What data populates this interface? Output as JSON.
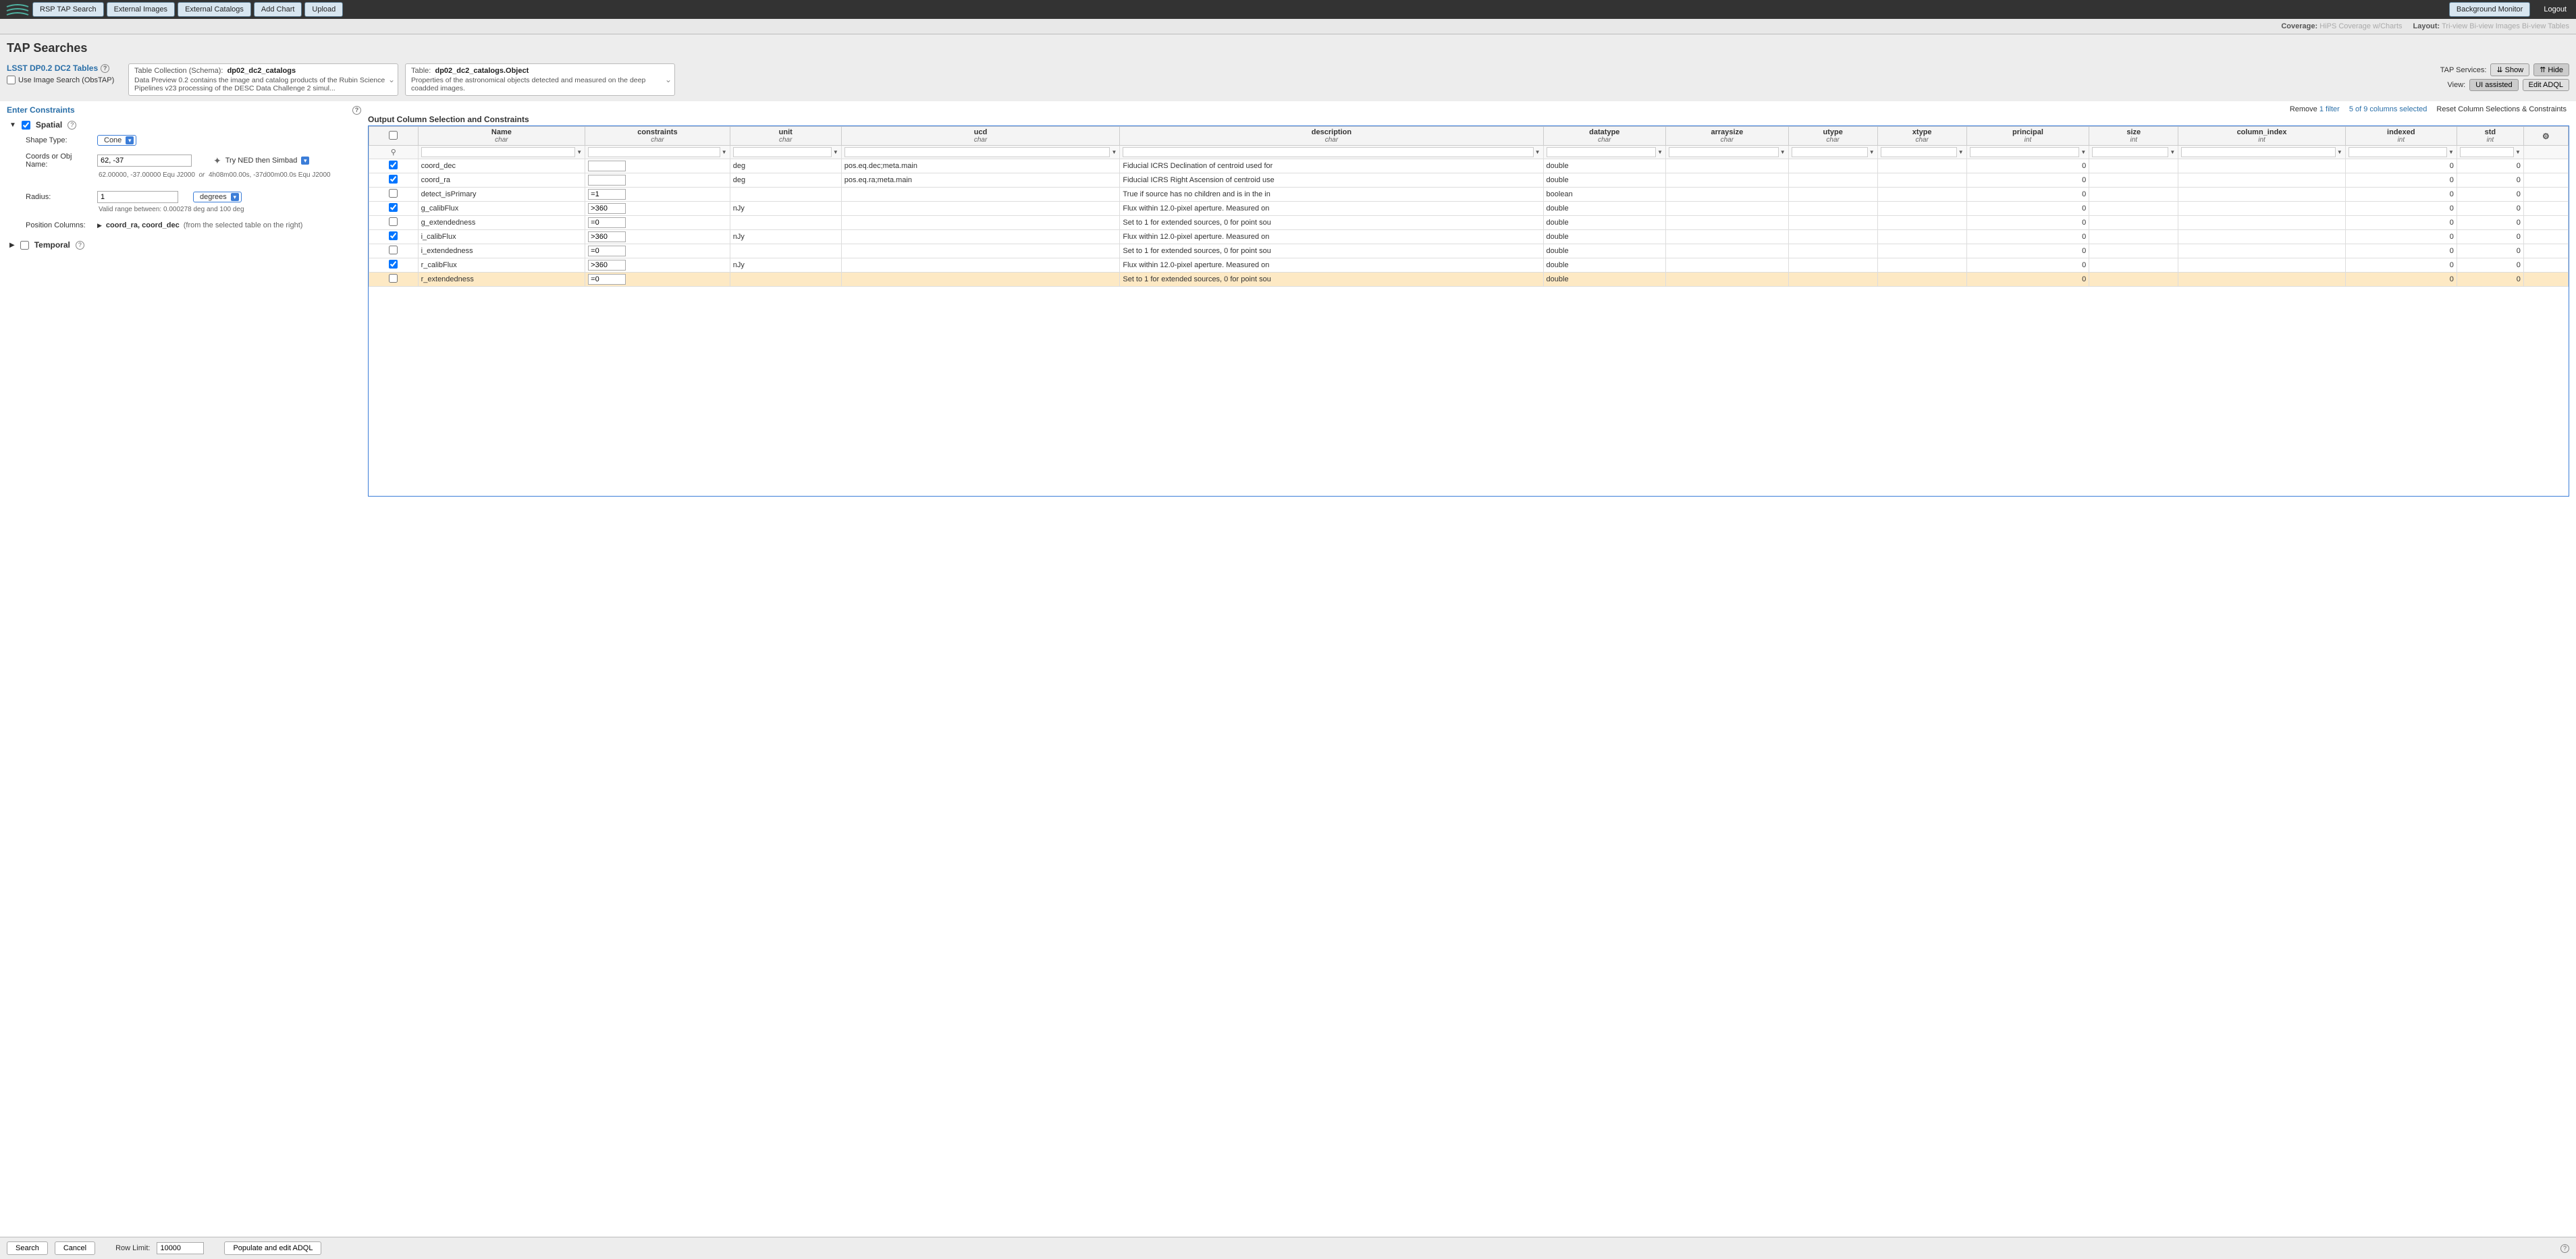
{
  "topbar": {
    "buttons": [
      "RSP TAP Search",
      "External Images",
      "External Catalogs",
      "Add Chart",
      "Upload"
    ],
    "bg_monitor": "Background Monitor",
    "logout": "Logout"
  },
  "subbar": {
    "coverage_label": "Coverage:",
    "coverage_items": [
      "HiPS",
      "Coverage w/Charts"
    ],
    "layout_label": "Layout:",
    "layout_items": [
      "Tri-view",
      "Bi-view Images",
      "Bi-view Tables"
    ]
  },
  "page_title": "TAP Searches",
  "schema": {
    "left_title": "LSST DP0.2 DC2 Tables",
    "use_image_label": "Use Image Search (ObsTAP)",
    "collection_label": "Table Collection (Schema):",
    "collection_value": "dp02_dc2_catalogs",
    "collection_desc": "Data Preview 0.2 contains the image and catalog products of the Rubin Science Pipelines v23 processing of the DESC Data Challenge 2 simul...",
    "table_label": "Table:",
    "table_value": "dp02_dc2_catalogs.Object",
    "table_desc": "Properties of the astronomical objects detected and measured on the deep coadded images.",
    "tap_services_label": "TAP Services:",
    "show": "Show",
    "hide": "Hide",
    "view_label": "View:",
    "ui_assisted": "UI assisted",
    "edit_adql": "Edit ADQL"
  },
  "constraints": {
    "header": "Enter Constraints",
    "spatial": {
      "label": "Spatial",
      "shape_label": "Shape Type:",
      "shape_value": "Cone",
      "coords_label": "Coords or Obj Name:",
      "coords_value": "62, -37",
      "try_ned": "Try NED then Simbad",
      "coords_hint_1": "62.00000, -37.00000  Equ J2000",
      "coords_hint_or": "or",
      "coords_hint_2": "4h08m00.00s, -37d00m00.0s  Equ J2000",
      "radius_label": "Radius:",
      "radius_value": "1",
      "radius_unit": "degrees",
      "radius_hint": "Valid range between: 0.000278 deg and 100 deg",
      "poscol_label": "Position Columns:",
      "poscol_value": "coord_ra, coord_dec",
      "poscol_hint": "(from the selected table on the right)"
    },
    "temporal": {
      "label": "Temporal"
    }
  },
  "right": {
    "remove_filter_pre": "Remove ",
    "remove_filter_link": "1 filter",
    "cols_selected": "5 of 9 columns selected",
    "reset": "Reset Column Selections & Constraints",
    "section_title": "Output Column Selection and Constraints"
  },
  "columns": [
    {
      "name": "Name",
      "type": "char",
      "w": 75
    },
    {
      "name": "constraints",
      "type": "char",
      "w": 65
    },
    {
      "name": "unit",
      "type": "char",
      "w": 50
    },
    {
      "name": "ucd",
      "type": "char",
      "w": 125
    },
    {
      "name": "description",
      "type": "char",
      "w": 190
    },
    {
      "name": "datatype",
      "type": "char",
      "w": 55
    },
    {
      "name": "arraysize",
      "type": "char",
      "w": 55
    },
    {
      "name": "utype",
      "type": "char",
      "w": 40
    },
    {
      "name": "xtype",
      "type": "char",
      "w": 40
    },
    {
      "name": "principal",
      "type": "int",
      "w": 55
    },
    {
      "name": "size",
      "type": "int",
      "w": 40
    },
    {
      "name": "column_index",
      "type": "int",
      "w": 75
    },
    {
      "name": "indexed",
      "type": "int",
      "w": 50
    },
    {
      "name": "std",
      "type": "int",
      "w": 30
    }
  ],
  "rows": [
    {
      "sel": true,
      "name": "coord_dec",
      "con": "",
      "unit": "deg",
      "ucd": "pos.eq.dec;meta.main",
      "desc": "Fiducial ICRS Declination of centroid used for",
      "dt": "double",
      "principal": "0",
      "indexed": "0",
      "std": "0"
    },
    {
      "sel": true,
      "name": "coord_ra",
      "con": "",
      "unit": "deg",
      "ucd": "pos.eq.ra;meta.main",
      "desc": "Fiducial ICRS Right Ascension of centroid use",
      "dt": "double",
      "principal": "0",
      "indexed": "0",
      "std": "0"
    },
    {
      "sel": false,
      "name": "detect_isPrimary",
      "con": "=1",
      "unit": "",
      "ucd": "",
      "desc": "True if source has no children and is in the in",
      "dt": "boolean",
      "principal": "0",
      "indexed": "0",
      "std": "0"
    },
    {
      "sel": true,
      "name": "g_calibFlux",
      "con": ">360",
      "unit": "nJy",
      "ucd": "",
      "desc": "Flux within 12.0-pixel aperture. Measured on",
      "dt": "double",
      "principal": "0",
      "indexed": "0",
      "std": "0"
    },
    {
      "sel": false,
      "name": "g_extendedness",
      "con": "=0",
      "unit": "",
      "ucd": "",
      "desc": "Set to 1 for extended sources, 0 for point sou",
      "dt": "double",
      "principal": "0",
      "indexed": "0",
      "std": "0"
    },
    {
      "sel": true,
      "name": "i_calibFlux",
      "con": ">360",
      "unit": "nJy",
      "ucd": "",
      "desc": "Flux within 12.0-pixel aperture. Measured on",
      "dt": "double",
      "principal": "0",
      "indexed": "0",
      "std": "0"
    },
    {
      "sel": false,
      "name": "i_extendedness",
      "con": "=0",
      "unit": "",
      "ucd": "",
      "desc": "Set to 1 for extended sources, 0 for point sou",
      "dt": "double",
      "principal": "0",
      "indexed": "0",
      "std": "0"
    },
    {
      "sel": true,
      "name": "r_calibFlux",
      "con": ">360",
      "unit": "nJy",
      "ucd": "",
      "desc": "Flux within 12.0-pixel aperture. Measured on",
      "dt": "double",
      "principal": "0",
      "indexed": "0",
      "std": "0"
    },
    {
      "sel": false,
      "hl": true,
      "name": "r_extendedness",
      "con": "=0",
      "unit": "",
      "ucd": "",
      "desc": "Set to 1 for extended sources, 0 for point sou",
      "dt": "double",
      "principal": "0",
      "indexed": "0",
      "std": "0"
    }
  ],
  "bottom": {
    "search": "Search",
    "cancel": "Cancel",
    "rowlimit_label": "Row Limit:",
    "rowlimit_value": "10000",
    "populate": "Populate and edit ADQL"
  }
}
